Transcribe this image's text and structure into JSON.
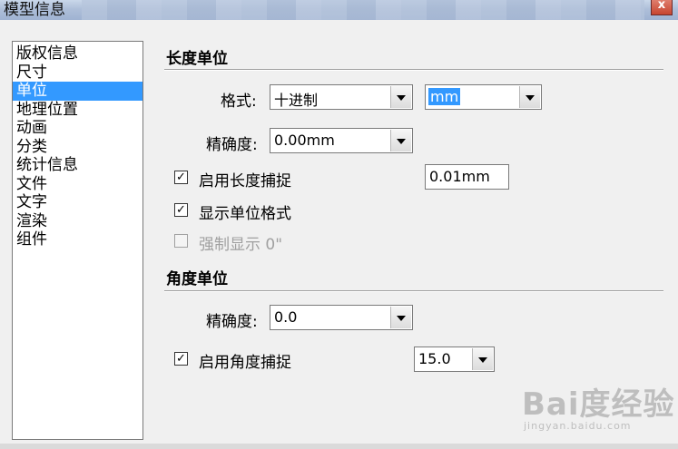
{
  "window": {
    "title": "模型信息",
    "close_glyph": "x"
  },
  "sidebar": {
    "items": [
      {
        "label": "版权信息"
      },
      {
        "label": "尺寸"
      },
      {
        "label": "单位",
        "selected": true
      },
      {
        "label": "地理位置"
      },
      {
        "label": "动画"
      },
      {
        "label": "分类"
      },
      {
        "label": "统计信息"
      },
      {
        "label": "文件"
      },
      {
        "label": "文字"
      },
      {
        "label": "渲染"
      },
      {
        "label": "组件"
      }
    ]
  },
  "length_units": {
    "title": "长度单位",
    "format_label": "格式:",
    "format_value": "十进制",
    "unit_value": "mm",
    "precision_label": "精确度:",
    "precision_value": "0.00mm",
    "snap_label": "启用长度捕捉",
    "snap_checked": true,
    "snap_value": "0.01mm",
    "show_format_label": "显示单位格式",
    "show_format_checked": true,
    "force_label": "强制显示 0\"",
    "force_checked": false
  },
  "angle_units": {
    "title": "角度单位",
    "precision_label": "精确度:",
    "precision_value": "0.0",
    "snap_label": "启用角度捕捉",
    "snap_checked": true,
    "snap_value": "15.0"
  },
  "watermark": {
    "logo": "Bai度经验",
    "url": "jingyan.baidu.com"
  },
  "check_glyph": "✓"
}
